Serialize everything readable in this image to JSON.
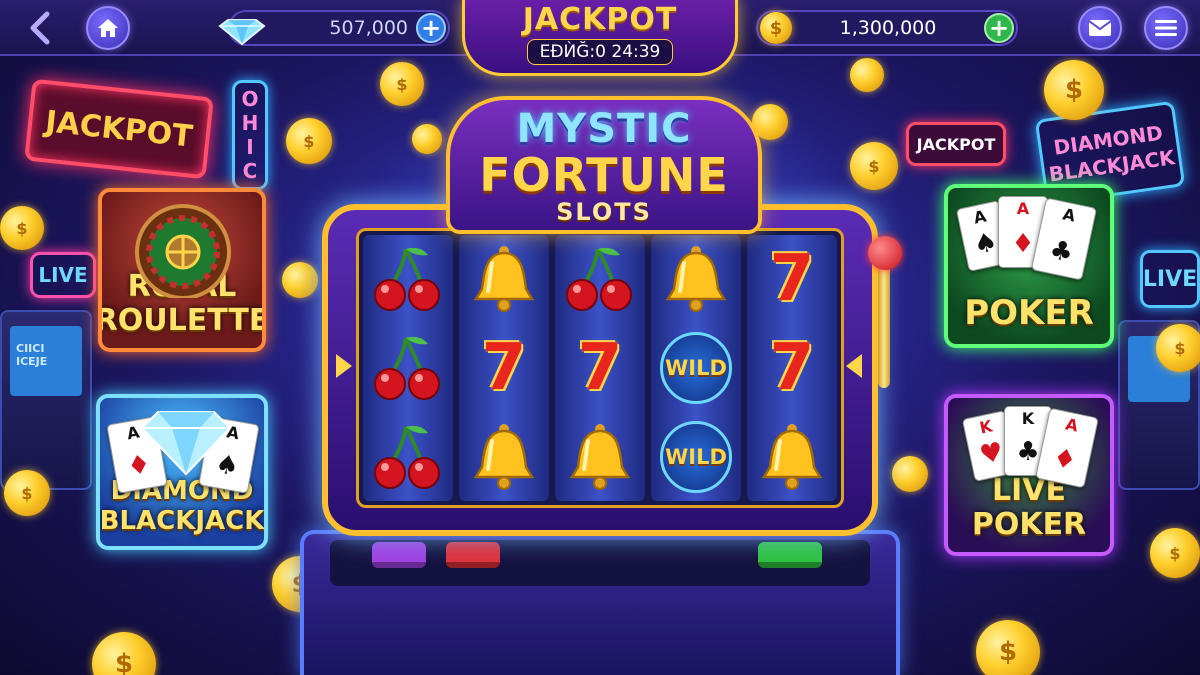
{
  "topbar": {
    "gems": "507,000",
    "coins": "1,300,000",
    "plus_symbol": "+",
    "back_symbol": "<"
  },
  "jackpot": {
    "title": "JACKPOT",
    "timer": "ЕÐЍĞ:0 24:39"
  },
  "machine": {
    "logo_line1": "MYSTIC",
    "logo_line2": "FORTUNE",
    "logo_line3": "SLOTS",
    "reels": [
      [
        "cherry",
        "cherry",
        "cherry"
      ],
      [
        "bell",
        "seven",
        "bell"
      ],
      [
        "cherry",
        "seven",
        "bell"
      ],
      [
        "bell",
        "wild",
        "wild"
      ],
      [
        "seven",
        "seven",
        "bell"
      ]
    ],
    "wild_label": "WILD",
    "seven_label": "7"
  },
  "games": {
    "roulette": {
      "line1": "ROYAL",
      "line2": "ROULETTE"
    },
    "blackjack": {
      "line1": "DIAMOND",
      "line2": "BLACKJACK"
    },
    "poker": {
      "label": "POKER"
    },
    "live_poker": {
      "line1": "LIVE",
      "line2": "POKER"
    }
  },
  "signs": {
    "jackpot_left": "JACKPOT",
    "ohic": [
      "O",
      "H",
      "I",
      "C"
    ],
    "live_left": "LIVE",
    "jackpot_right": "JACKPOT",
    "diamond_right_1": "DIAMOND",
    "diamond_right_2": "BLACKJACK",
    "live_right": "LIVE",
    "arcade_screen": "CIICI ICEJE"
  },
  "cards": {
    "ace": "A",
    "king": "K",
    "spade": "♠",
    "heart": "♥",
    "diamond": "♦",
    "club": "♣"
  },
  "colors": {
    "gold": "#ffd54a",
    "gem_plus": "#2f7ee8",
    "coin_plus": "#2fb84a",
    "spin_purple": "#a040e0",
    "spin_red": "#e0303a",
    "spin_green": "#30c040"
  }
}
